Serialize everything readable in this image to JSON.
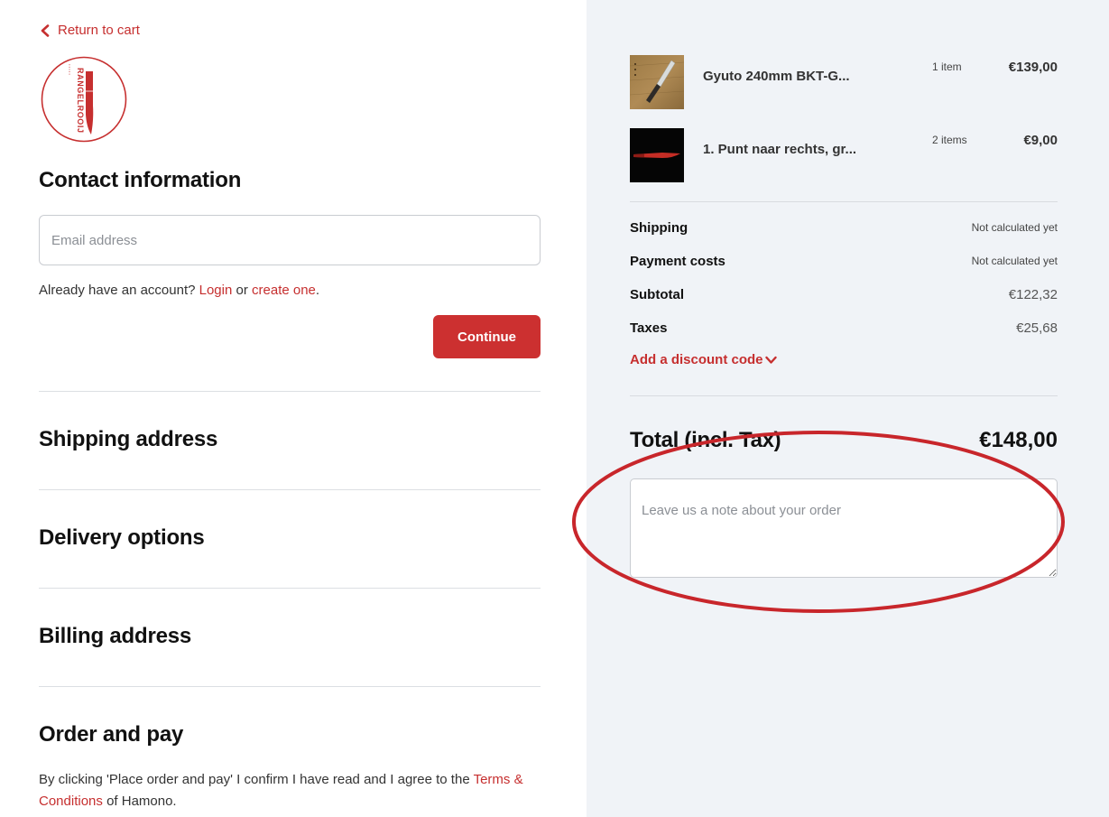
{
  "nav": {
    "return_label": "Return to cart"
  },
  "logo": {
    "text": "RANGELROOIJ"
  },
  "contact": {
    "title": "Contact information",
    "email_placeholder": "Email address",
    "account_prefix": "Already have an account?",
    "login_label": "Login",
    "or_text": "or",
    "create_label": "create one",
    "period": ".",
    "continue_label": "Continue"
  },
  "sections": {
    "shipping": "Shipping address",
    "delivery": "Delivery options",
    "billing": "Billing address",
    "order": "Order and pay"
  },
  "terms": {
    "prefix": "By clicking 'Place order and pay' I confirm I have read and I agree to the",
    "link": "Terms & Conditions",
    "suffix": "of Hamono."
  },
  "cart": {
    "items": [
      {
        "name": "Gyuto 240mm BKT-G...",
        "qty": "1 item",
        "price": "€139,00",
        "thumb_icon": "knife-on-wood-icon"
      },
      {
        "name": "1. Punt naar rechts, gr...",
        "qty": "2 items",
        "price": "€9,00",
        "thumb_icon": "red-knife-icon"
      }
    ]
  },
  "summary": {
    "shipping_label": "Shipping",
    "shipping_value": "Not calculated yet",
    "payment_label": "Payment costs",
    "payment_value": "Not calculated yet",
    "subtotal_label": "Subtotal",
    "subtotal_value": "€122,32",
    "taxes_label": "Taxes",
    "taxes_value": "€25,68",
    "discount_label": "Add a discount code",
    "total_label": "Total (incl. Tax)",
    "total_value": "€148,00",
    "note_placeholder": "Leave us a note about your order"
  },
  "colors": {
    "accent": "#cc3030",
    "right_panel_bg": "#f0f3f7",
    "annotation": "#c8262b"
  }
}
